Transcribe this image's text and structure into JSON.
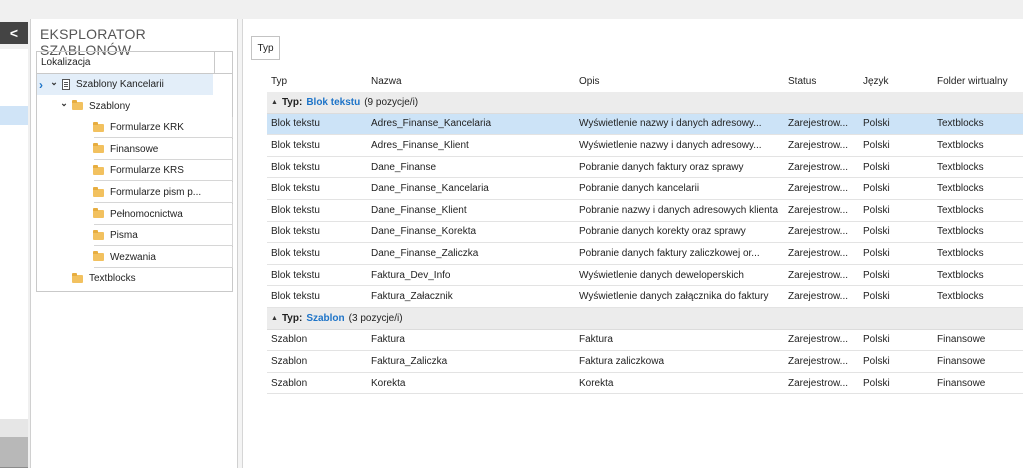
{
  "rail": {
    "back_icon": "chevron-left-icon",
    "back_glyph": "<"
  },
  "explorer": {
    "title": "EKSPLORATOR SZABLONÓW",
    "column_header": "Lokalizacja",
    "tree": [
      {
        "label": "Szablony Kancelarii",
        "level": 0,
        "icon": "document-icon",
        "expanded": true,
        "selected": true
      },
      {
        "label": "Szablony",
        "level": 1,
        "icon": "folder-icon",
        "expanded": true
      },
      {
        "label": "Formularze KRK",
        "level": 2,
        "icon": "folder-icon"
      },
      {
        "label": "Finansowe",
        "level": 2,
        "icon": "folder-icon"
      },
      {
        "label": "Formularze KRS",
        "level": 2,
        "icon": "folder-icon"
      },
      {
        "label": "Formularze pism p...",
        "level": 2,
        "icon": "folder-icon"
      },
      {
        "label": "Pełnomocnictwa",
        "level": 2,
        "icon": "folder-icon"
      },
      {
        "label": "Pisma",
        "level": 2,
        "icon": "folder-icon"
      },
      {
        "label": "Wezwania",
        "level": 2,
        "icon": "folder-icon"
      },
      {
        "label": "Textblocks",
        "level": 1,
        "icon": "folder-icon"
      }
    ]
  },
  "main": {
    "group_by_button": "Typ",
    "columns": [
      "Typ",
      "Nazwa",
      "Opis",
      "Status",
      "Język",
      "Folder wirtualny"
    ],
    "groups": [
      {
        "prefix": "Typ:",
        "value": "Blok tekstu",
        "count": "(9 pozycje/i)",
        "rows": [
          [
            "Blok tekstu",
            "Adres_Finanse_Kancelaria",
            "Wyświetlenie nazwy i danych adresowy...",
            "Zarejestrow...",
            "Polski",
            "Textblocks"
          ],
          [
            "Blok tekstu",
            "Adres_Finanse_Klient",
            "Wyświetlenie nazwy i danych adresowy...",
            "Zarejestrow...",
            "Polski",
            "Textblocks"
          ],
          [
            "Blok tekstu",
            "Dane_Finanse",
            "Pobranie danych faktury oraz sprawy",
            "Zarejestrow...",
            "Polski",
            "Textblocks"
          ],
          [
            "Blok tekstu",
            "Dane_Finanse_Kancelaria",
            "Pobranie danych kancelarii",
            "Zarejestrow...",
            "Polski",
            "Textblocks"
          ],
          [
            "Blok tekstu",
            "Dane_Finanse_Klient",
            "Pobranie nazwy i danych adresowych klienta",
            "Zarejestrow...",
            "Polski",
            "Textblocks"
          ],
          [
            "Blok tekstu",
            "Dane_Finanse_Korekta",
            "Pobranie danych korekty oraz sprawy",
            "Zarejestrow...",
            "Polski",
            "Textblocks"
          ],
          [
            "Blok tekstu",
            "Dane_Finanse_Zaliczka",
            "Pobranie danych faktury zaliczkowej or...",
            "Zarejestrow...",
            "Polski",
            "Textblocks"
          ],
          [
            "Blok tekstu",
            "Faktura_Dev_Info",
            "Wyświetlenie danych deweloperskich",
            "Zarejestrow...",
            "Polski",
            "Textblocks"
          ],
          [
            "Blok tekstu",
            "Faktura_Załacznik",
            "Wyświetlenie danych załącznika do faktury",
            "Zarejestrow...",
            "Polski",
            "Textblocks"
          ]
        ]
      },
      {
        "prefix": "Typ:",
        "value": "Szablon",
        "count": "(3 pozycje/i)",
        "rows": [
          [
            "Szablon",
            "Faktura",
            "Faktura",
            "Zarejestrow...",
            "Polski",
            "Finansowe"
          ],
          [
            "Szablon",
            "Faktura_Zaliczka",
            "Faktura zaliczkowa",
            "Zarejestrow...",
            "Polski",
            "Finansowe"
          ],
          [
            "Szablon",
            "Korekta",
            "Korekta",
            "Zarejestrow...",
            "Polski",
            "Finansowe"
          ]
        ]
      }
    ]
  },
  "colors": {
    "accent": "#1e74c8",
    "selection": "#cce3f7",
    "group_bg": "#ececec"
  }
}
